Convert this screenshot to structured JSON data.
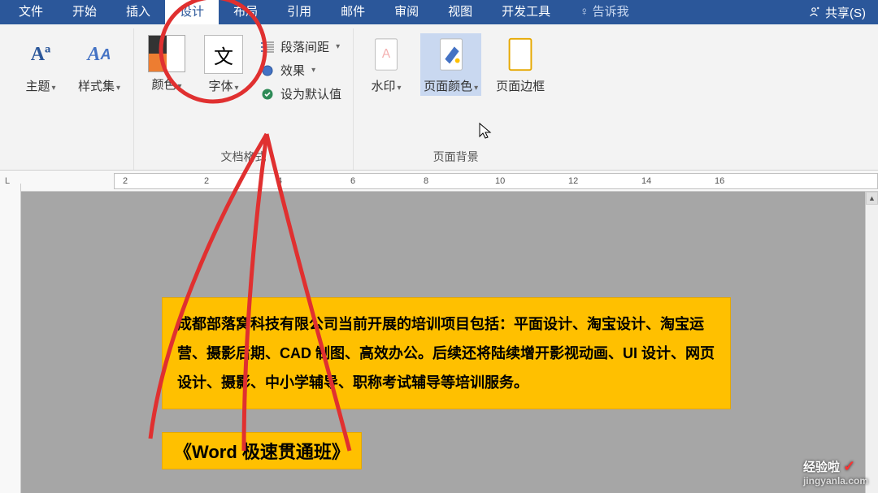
{
  "menu": {
    "file": "文件",
    "home": "开始",
    "insert": "插入",
    "design": "设计",
    "layout": "布局",
    "references": "引用",
    "mail": "邮件",
    "review": "审阅",
    "view": "视图",
    "dev": "开发工具",
    "tellme": "告诉我",
    "share": "共享(S)"
  },
  "ribbon": {
    "themes": "主题",
    "stylesets": "样式集",
    "colors": "颜色",
    "fonts": "字体",
    "para_spacing": "段落间距",
    "effects": "效果",
    "set_default": "设为默认值",
    "doc_format": "文档格式",
    "watermark": "水印",
    "page_color": "页面颜色",
    "page_border": "页面边框",
    "page_bg": "页面背景"
  },
  "ruler_corner": "L",
  "ruler_ticks": [
    "2",
    "|",
    "|",
    "2",
    "|",
    "|",
    "4",
    "|",
    "|",
    "6",
    "|",
    "|",
    "8",
    "|",
    "|",
    "10",
    "|",
    "|",
    "12",
    "|",
    "|",
    "14",
    "|",
    "|",
    "16",
    "|"
  ],
  "doc": {
    "para1": "成都部落窝科技有限公司当前开展的培训项目包括：平面设计、淘宝设计、淘宝运营、摄影后期、CAD 制图、高效办公。后续还将陆续增开影视动画、UI 设计、网页设计、摄影、中小学辅导、职称考试辅导等培训服务。",
    "para2": "《Word 极速贯通班》"
  },
  "watermark_text": "经验啦",
  "watermark_url": "jingyanla.com"
}
